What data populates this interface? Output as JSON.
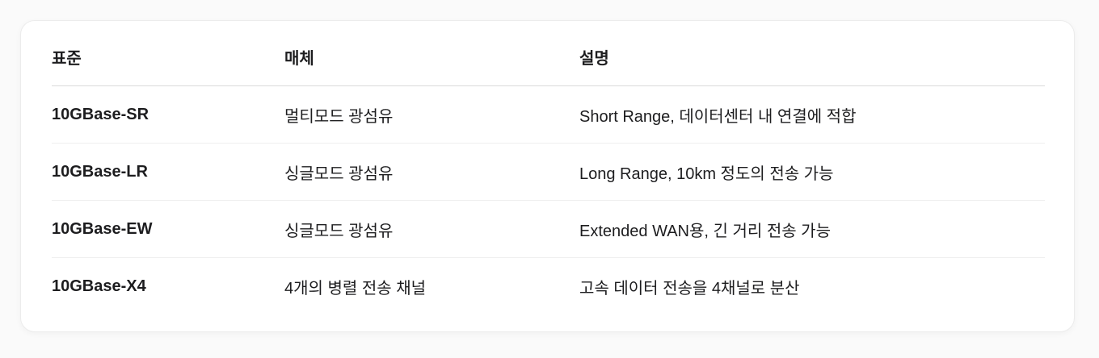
{
  "table": {
    "headers": [
      "표준",
      "매체",
      "설명"
    ],
    "rows": [
      {
        "standard": "10GBase-SR",
        "media": "멀티모드 광섬유",
        "description": "Short Range, 데이터센터 내 연결에 적합"
      },
      {
        "standard": "10GBase-LR",
        "media": "싱글모드 광섬유",
        "description": "Long Range, 10km 정도의 전송 가능"
      },
      {
        "standard": "10GBase-EW",
        "media": "싱글모드 광섬유",
        "description": "Extended WAN용, 긴 거리 전송 가능"
      },
      {
        "standard": "10GBase-X4",
        "media": "4개의 병렬 전송 채널",
        "description": "고속 데이터 전송을 4채널로 분산"
      }
    ]
  }
}
